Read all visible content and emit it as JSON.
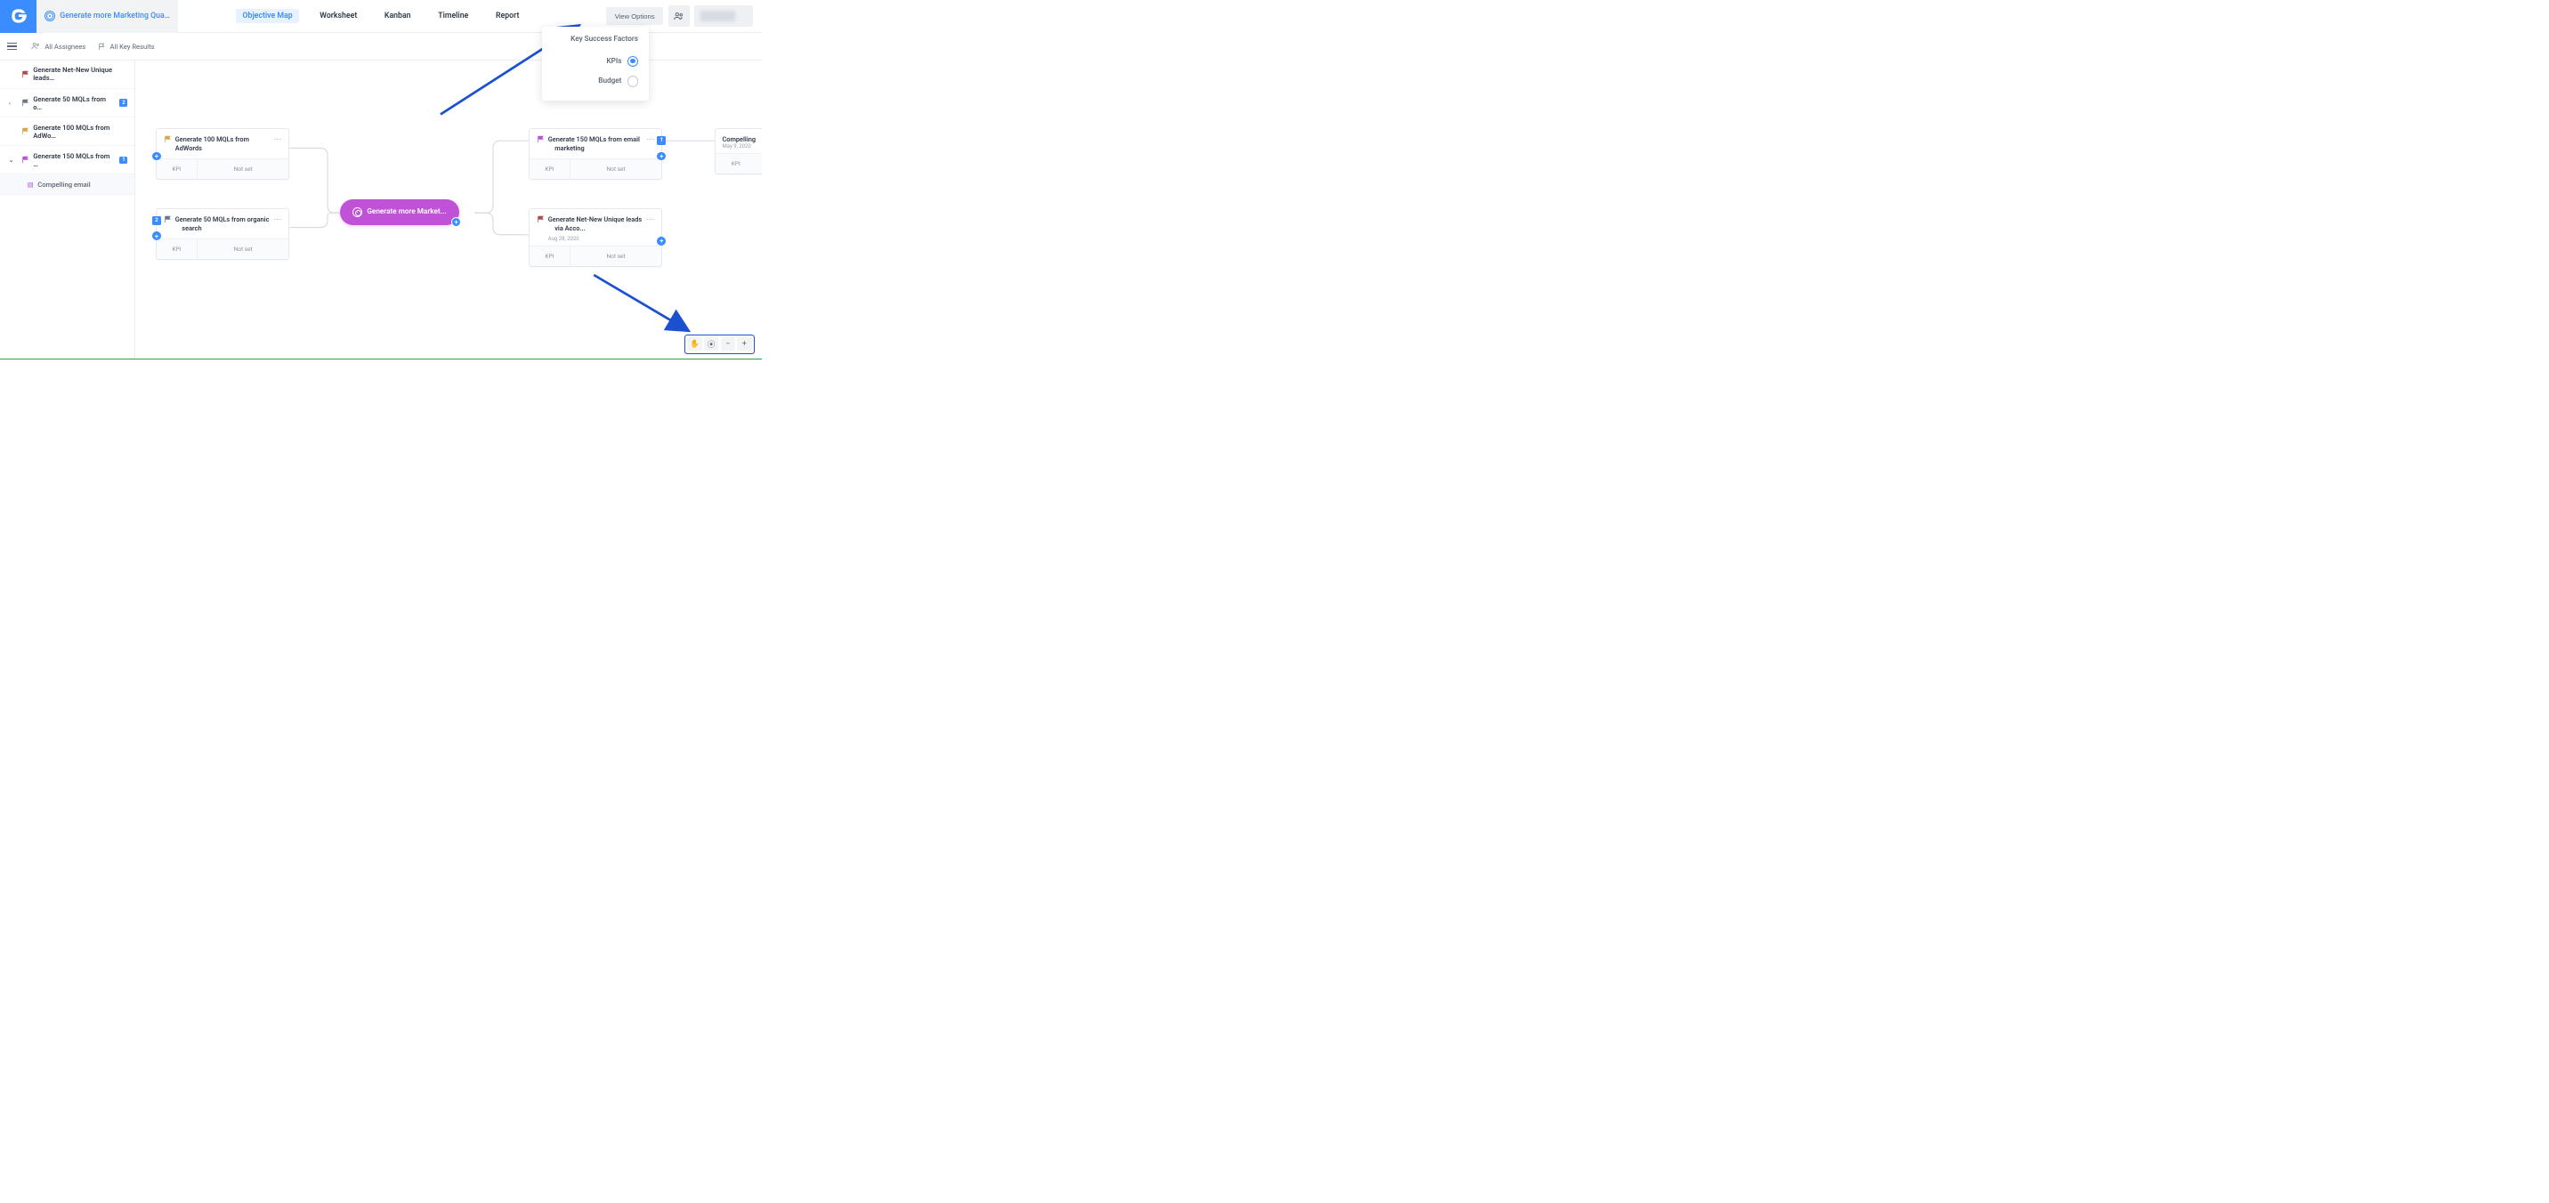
{
  "breadcrumb": "Generate more Marketing Qua…",
  "tabs": [
    "Objective Map",
    "Worksheet",
    "Kanban",
    "Timeline",
    "Report"
  ],
  "active_tab": 0,
  "header": {
    "view_options": "View Options"
  },
  "filters": {
    "assignees": "All Assignees",
    "keyresults": "All Key Results"
  },
  "sidebar": [
    {
      "label": "Generate Net-New Unique leads…",
      "flag": "#b54a4a",
      "chev": ""
    },
    {
      "label": "Generate 50 MQLs from o…",
      "flag": "#6b7685",
      "badge": "2",
      "chev": "›"
    },
    {
      "label": "Generate 100 MQLs from AdWo…",
      "flag": "#d6a84a",
      "chev": ""
    },
    {
      "label": "Generate 150 MQLs from …",
      "flag": "#c052d8",
      "badge": "1",
      "chev": "⌄"
    },
    {
      "label": "Compelling email",
      "leaf": true
    }
  ],
  "nodes": {
    "c1": {
      "title": "Generate 100 MQLs from AdWords",
      "flag": "#d6a84a",
      "kpi": "KPI",
      "val": "Not set"
    },
    "c2": {
      "title": "Generate 50 MQLs from organic  search",
      "flag": "#6b7685",
      "badge": "2",
      "kpi": "KPI",
      "val": "Not set"
    },
    "c3": {
      "title": "Generate 150 MQLs from email  marketing",
      "flag": "#c052d8",
      "badge": "1",
      "kpi": "KPI",
      "val": "Not set"
    },
    "c4": {
      "title": "Generate Net-New Unique leads  via Acco...",
      "flag": "#b54a4a",
      "date": "Aug 28, 2020",
      "kpi": "KPI",
      "val": "Not set"
    },
    "c5": {
      "title": "Compelling",
      "date": "May 9, 2020",
      "kpi": "KPI"
    },
    "center": "Generate more Market..."
  },
  "dropdown": {
    "title": "Key Success Factors",
    "options": [
      {
        "label": "KPIs",
        "selected": true
      },
      {
        "label": "Budget",
        "selected": false
      }
    ]
  },
  "colors": {
    "primary": "#3b8cff",
    "accent": "#c052d8",
    "annot": "#1b51d1"
  }
}
